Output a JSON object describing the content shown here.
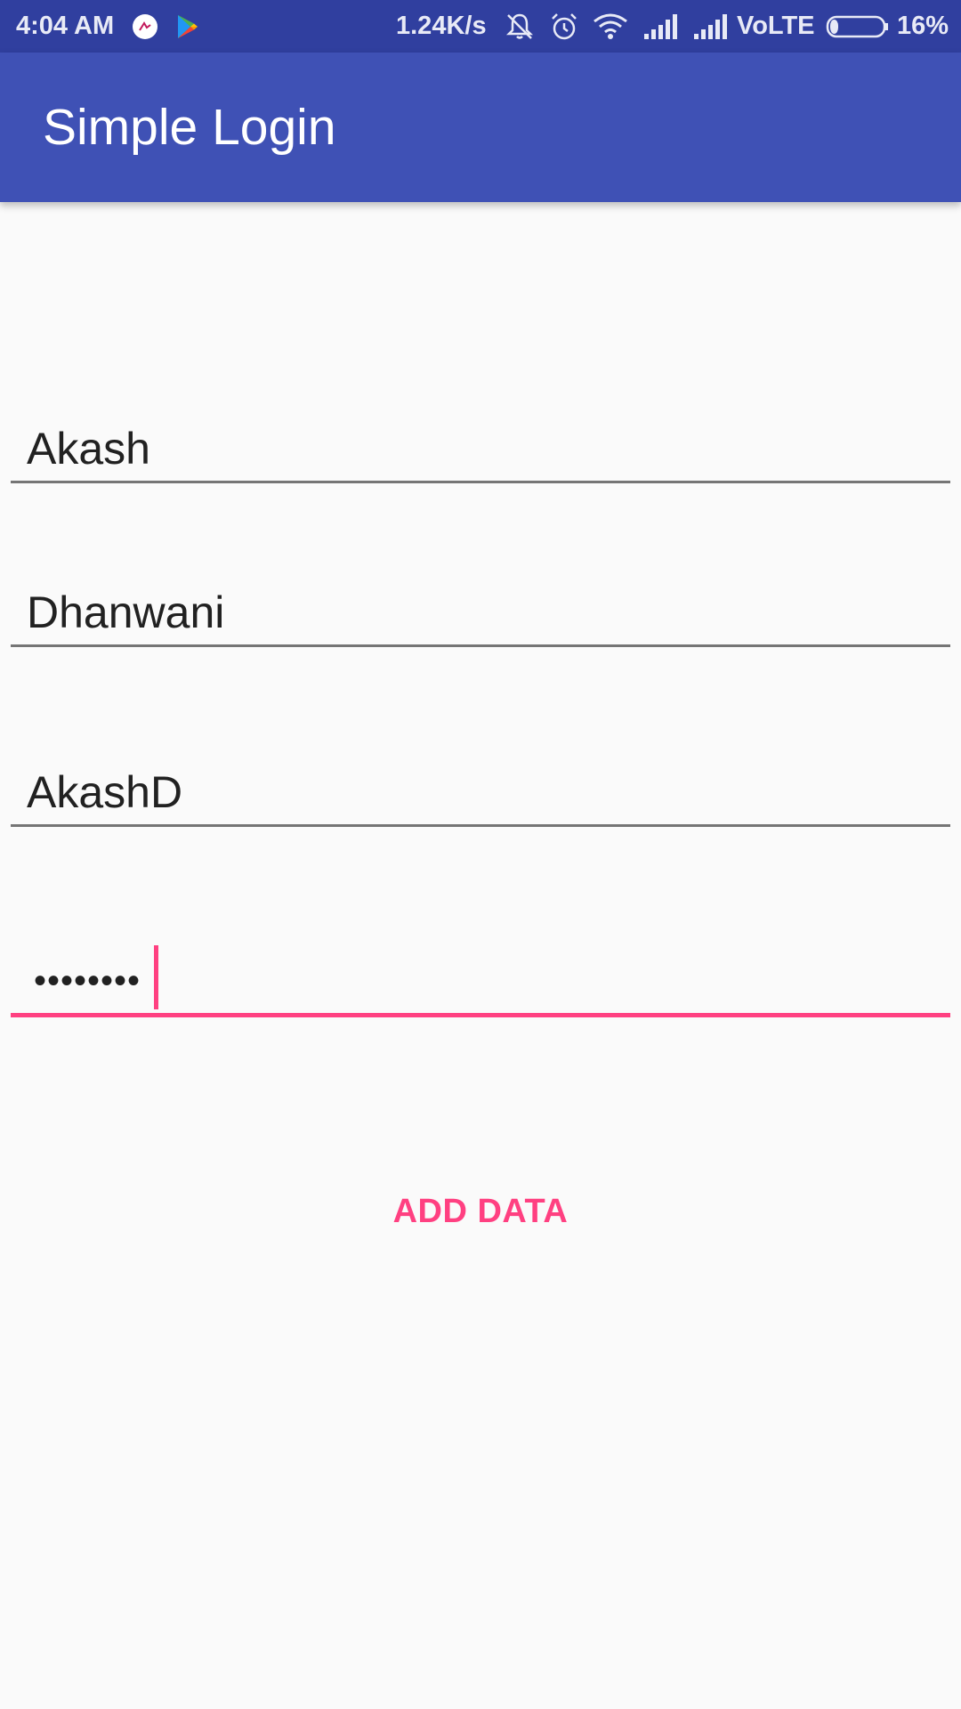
{
  "status_bar": {
    "time": "4:04 AM",
    "network_speed": "1.24K/s",
    "network_type": "VoLTE",
    "battery": "16%",
    "battery_level": 0.16,
    "icons": [
      "app-notification-icon",
      "play-store-icon",
      "mute-icon",
      "alarm-icon",
      "wifi-icon",
      "signal-icon",
      "signal-icon-2",
      "battery-icon"
    ]
  },
  "app_bar": {
    "title": "Simple Login"
  },
  "form": {
    "first_name": "Akash",
    "last_name": "Dhanwani",
    "username": "AkashD",
    "password_masked": "••••••••"
  },
  "button": {
    "label": "ADD DATA"
  },
  "colors": {
    "primary_dark": "#303f9f",
    "primary": "#3f51b5",
    "accent": "#ff4081",
    "background": "#fafafa"
  }
}
